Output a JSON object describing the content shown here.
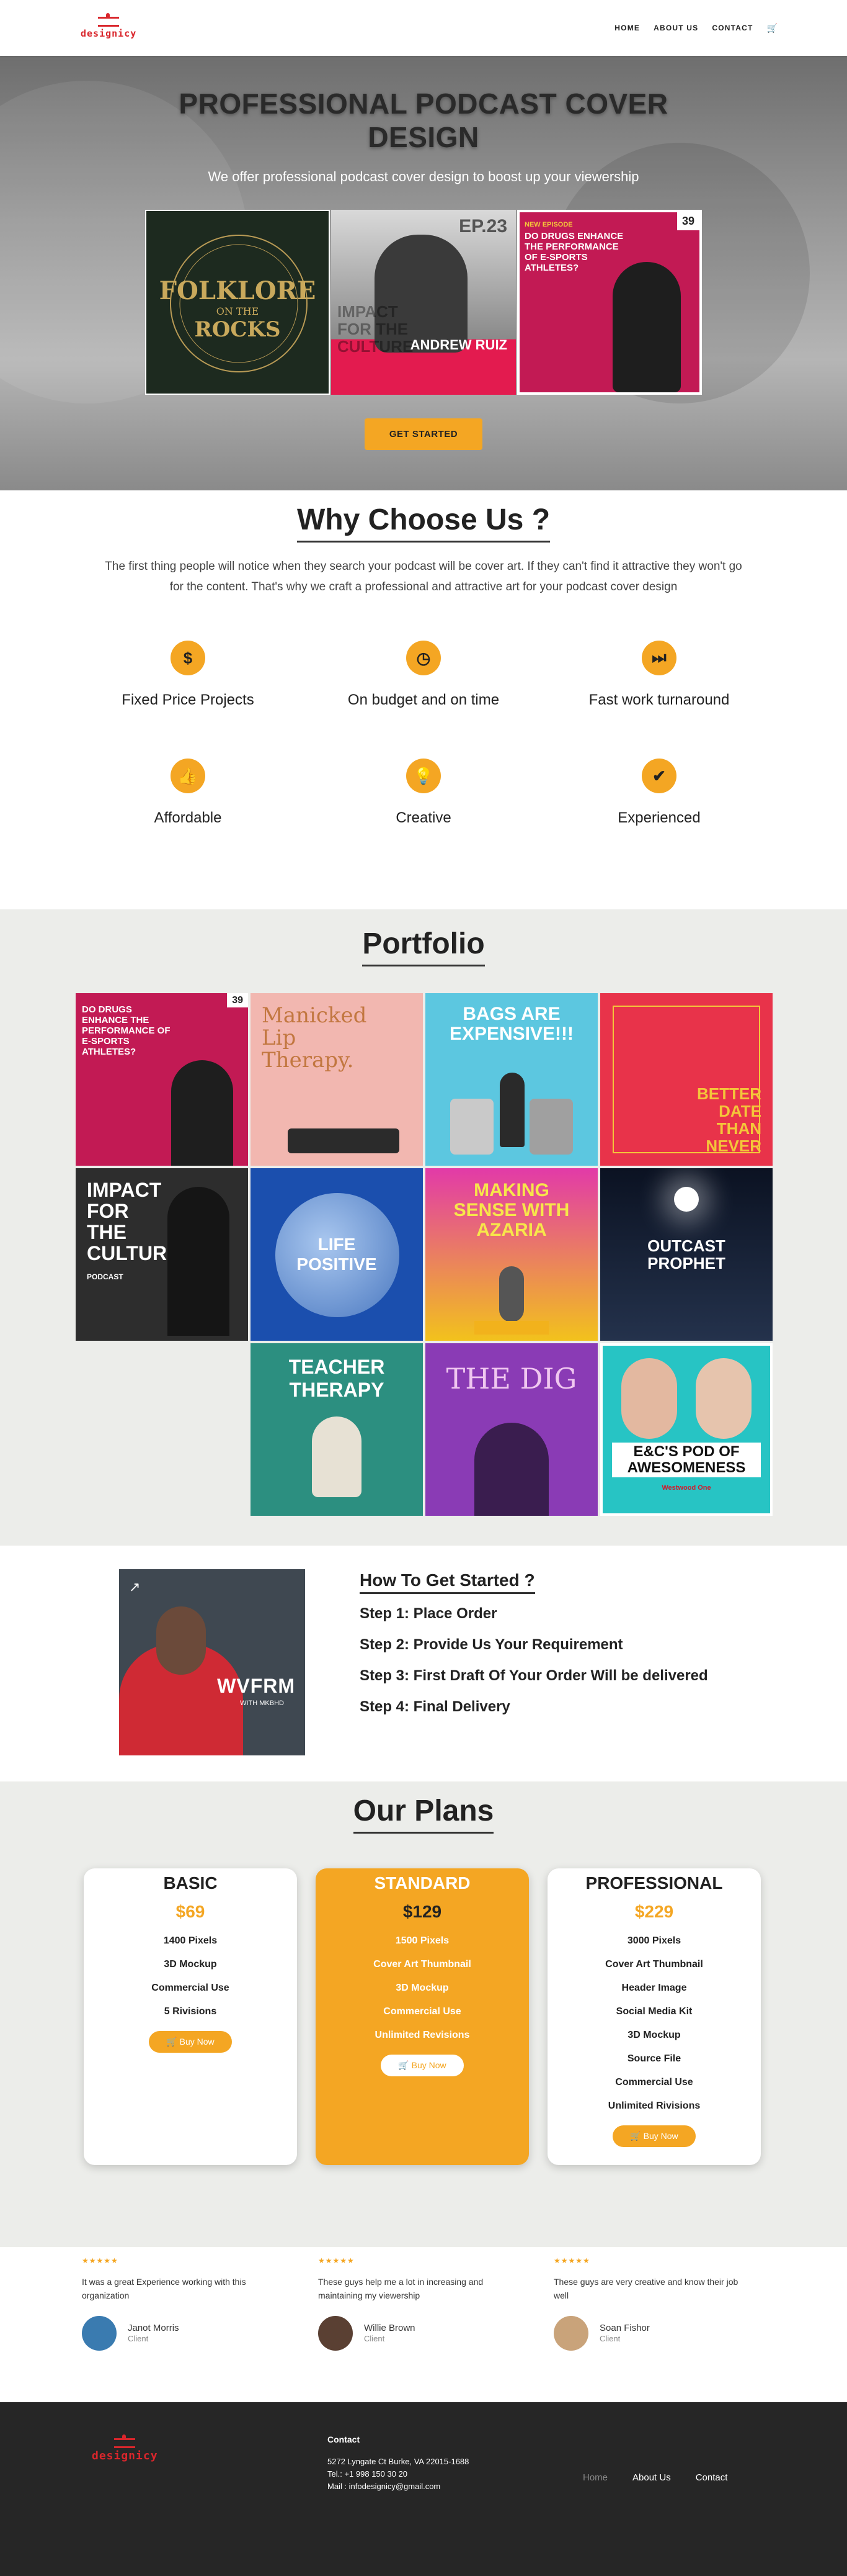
{
  "header": {
    "logo": "designicy",
    "nav": [
      "HOME",
      "ABOUT US",
      "CONTACT"
    ],
    "cart_icon": "cart-icon"
  },
  "hero": {
    "title": "PROFESSIONAL PODCAST COVER DESIGN",
    "subtitle": "We offer professional podcast cover design to boost up your viewership",
    "covers": [
      {
        "name": "folklore",
        "lines": [
          "FOLKLORE",
          "ON THE",
          "ROCKS"
        ]
      },
      {
        "name": "andrew-ruiz",
        "lines": [
          "EP.23",
          "ANDREW RUIZ",
          "IMPACT FOR THE CULTURE"
        ]
      },
      {
        "name": "esports",
        "lines": [
          "NEW EPISODE",
          "DO DRUGS ENHANCE THE PERFORMANCE OF E-SPORTS ATHLETES?",
          "39"
        ]
      }
    ],
    "cta": "GET STARTED"
  },
  "why": {
    "title": "Why Choose Us ?",
    "text": "The first thing people will notice when they search your podcast will be cover art.  If they can't find it attractive they won't go for the content. That's why we craft a professional and attractive art for your podcast cover design",
    "features": [
      {
        "label": "Fixed Price Projects",
        "icon": "dollar-icon",
        "glyph": "$"
      },
      {
        "label": "On budget and on time",
        "icon": "clock-icon",
        "glyph": "◷"
      },
      {
        "label": "Fast work turnaround",
        "icon": "fast-forward-icon",
        "glyph": "⏭"
      },
      {
        "label": "Affordable",
        "icon": "thumbs-up-icon",
        "glyph": "👍"
      },
      {
        "label": "Creative",
        "icon": "lightbulb-icon",
        "glyph": "💡"
      },
      {
        "label": "Experienced",
        "icon": "inbox-icon",
        "glyph": "✔"
      }
    ]
  },
  "portfolio": {
    "title": "Portfolio",
    "tiles": [
      {
        "text": "DO DRUGS ENHANCE THE PERFORMANCE OF E-SPORTS ATHLETES?",
        "sub": "39"
      },
      {
        "text": "Manicked Lip Therapy.",
        "sub": ""
      },
      {
        "text": "BAGS ARE EXPENSIVE!!!",
        "sub": ""
      },
      {
        "text": "BETTER DATE THAN NEVER",
        "sub": ""
      },
      {
        "text": "IMPACT FOR THE CULTURE",
        "sub": "PODCAST"
      },
      {
        "text": "LIFE POSITIVE",
        "sub": ""
      },
      {
        "text": "MAKING SENSE WITH AZARIA",
        "sub": ""
      },
      {
        "text": "OUTCAST PROPHET",
        "sub": ""
      },
      {
        "text": "TEACHER THERAPY",
        "sub": ""
      },
      {
        "text": "THE DIG",
        "sub": ""
      },
      {
        "text": "E&C'S POD OF AWESOMENESS",
        "sub": "Westwood One"
      }
    ]
  },
  "steps": {
    "art_title": "WVFRM",
    "art_sub": "WITH MKBHD",
    "title": "How To Get Started ?",
    "items": [
      "Step 1: Place Order",
      "Step 2: Provide Us Your Requirement",
      "Step 3: First Draft Of Your Order Will be delivered",
      "Step 4: Final Delivery"
    ]
  },
  "plans": {
    "title": "Our Plans",
    "cards": [
      {
        "name": "BASIC",
        "price": "$69",
        "features": [
          "1400 Pixels",
          "3D Mockup",
          "Commercial Use",
          "5 Rivisions"
        ],
        "cta": "Buy Now"
      },
      {
        "name": "STANDARD",
        "price": "$129",
        "features": [
          "1500 Pixels",
          "Cover Art Thumbnail",
          "3D Mockup",
          "Commercial Use",
          "Unlimited Revisions"
        ],
        "cta": "Buy Now"
      },
      {
        "name": "PROFESSIONAL",
        "price": "$229",
        "features": [
          "3000 Pixels",
          "Cover Art Thumbnail",
          "Header Image",
          "Social Media Kit",
          "3D Mockup",
          "Source File",
          "Commercial Use",
          "Unlimited Rivisions"
        ],
        "cta": "Buy Now"
      }
    ]
  },
  "testimonials": [
    {
      "stars": "★★★★★",
      "text": "It was a great Experience working with this organization",
      "name": "Janot Morris",
      "role": "Client"
    },
    {
      "stars": "★★★★★",
      "text": "These guys help me a lot in increasing and maintaining my viewership",
      "name": "Willie Brown",
      "role": "Client"
    },
    {
      "stars": "★★★★★",
      "text": "These guys are very creative and know their job well",
      "name": "Soan Fishor",
      "role": "Client"
    }
  ],
  "footer": {
    "logo": "designicy",
    "contact_title": "Contact",
    "address": "5272 Lyngate Ct Burke, VA 22015-1688",
    "tel": "Tel.: +1 998 150 30 20",
    "mail": "Mail : infodesignicy@gmail.com",
    "nav": [
      "Home",
      "About Us",
      "Contact"
    ]
  }
}
